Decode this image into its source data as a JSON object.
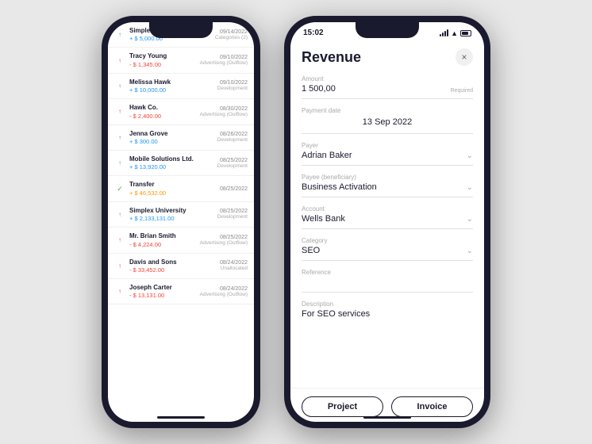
{
  "left_phone": {
    "transactions": [
      {
        "name": "Simplex University",
        "date": "09/14/2022",
        "amount": "+ $ 5,000.00",
        "amount_type": "positive",
        "category": "Categories (2)",
        "icon": "arrow_up"
      },
      {
        "name": "Tracy Young",
        "date": "09/10/2022",
        "amount": "- $ 1,345.00",
        "amount_type": "negative",
        "category": "Advertising (Outflow)",
        "icon": "arrow_up"
      },
      {
        "name": "Melissa Hawk",
        "date": "09/10/2022",
        "amount": "+ $ 10,000.00",
        "amount_type": "positive",
        "category": "Development",
        "icon": "arrow_up"
      },
      {
        "name": "Hawk Co.",
        "date": "08/30/2022",
        "amount": "- $ 2,400.00",
        "amount_type": "negative",
        "category": "Advertising (Outflow)",
        "icon": "arrow_up"
      },
      {
        "name": "Jenna Grove",
        "date": "08/26/2022",
        "amount": "+ $ 300.00",
        "amount_type": "positive",
        "category": "Development",
        "icon": "arrow_up"
      },
      {
        "name": "Mobile Solutions Ltd.",
        "date": "08/25/2022",
        "amount": "+ $ 13,920.00",
        "amount_type": "positive",
        "category": "Development",
        "icon": "arrow_up"
      },
      {
        "name": "Transfer",
        "date": "08/25/2022",
        "amount": "+ $ 46,532.00",
        "amount_type": "transfer",
        "category": "",
        "icon": "check"
      },
      {
        "name": "Simplex University",
        "date": "08/25/2022",
        "amount": "+ $ 2,133,131.00",
        "amount_type": "positive",
        "category": "Development",
        "icon": "arrow_up"
      },
      {
        "name": "Mr. Brian Smith",
        "date": "08/25/2022",
        "amount": "- $ 4,224.00",
        "amount_type": "negative",
        "category": "Advertising (Outflow)",
        "icon": "arrow_up"
      },
      {
        "name": "Davis and Sons",
        "date": "08/24/2022",
        "amount": "- $ 33,452.00",
        "amount_type": "negative",
        "category": "Unallocated",
        "icon": "arrow_up"
      },
      {
        "name": "Joseph Carter",
        "date": "08/24/2022",
        "amount": "- $ 13,131.00",
        "amount_type": "negative",
        "category": "Advertising (Outflow)",
        "icon": "arrow_up"
      }
    ]
  },
  "right_phone": {
    "status_time": "15:02",
    "title": "Revenue",
    "close_label": "×",
    "fields": {
      "amount_label": "Amount",
      "amount_value": "1 500,00",
      "amount_required": "Required",
      "payment_date_label": "Payment date",
      "payment_date_value": "13 Sep 2022",
      "payer_label": "Payer",
      "payer_value": "Adrian Baker",
      "payee_label": "Payee (beneficiary)",
      "payee_value": "Business Activation",
      "account_label": "Account",
      "account_value": "Wells Bank",
      "category_label": "Category",
      "category_value": "SEO",
      "reference_label": "Reference",
      "reference_value": "",
      "description_label": "Description",
      "description_value": "For SEO services"
    },
    "buttons": {
      "project": "Project",
      "invoice": "Invoice"
    }
  }
}
